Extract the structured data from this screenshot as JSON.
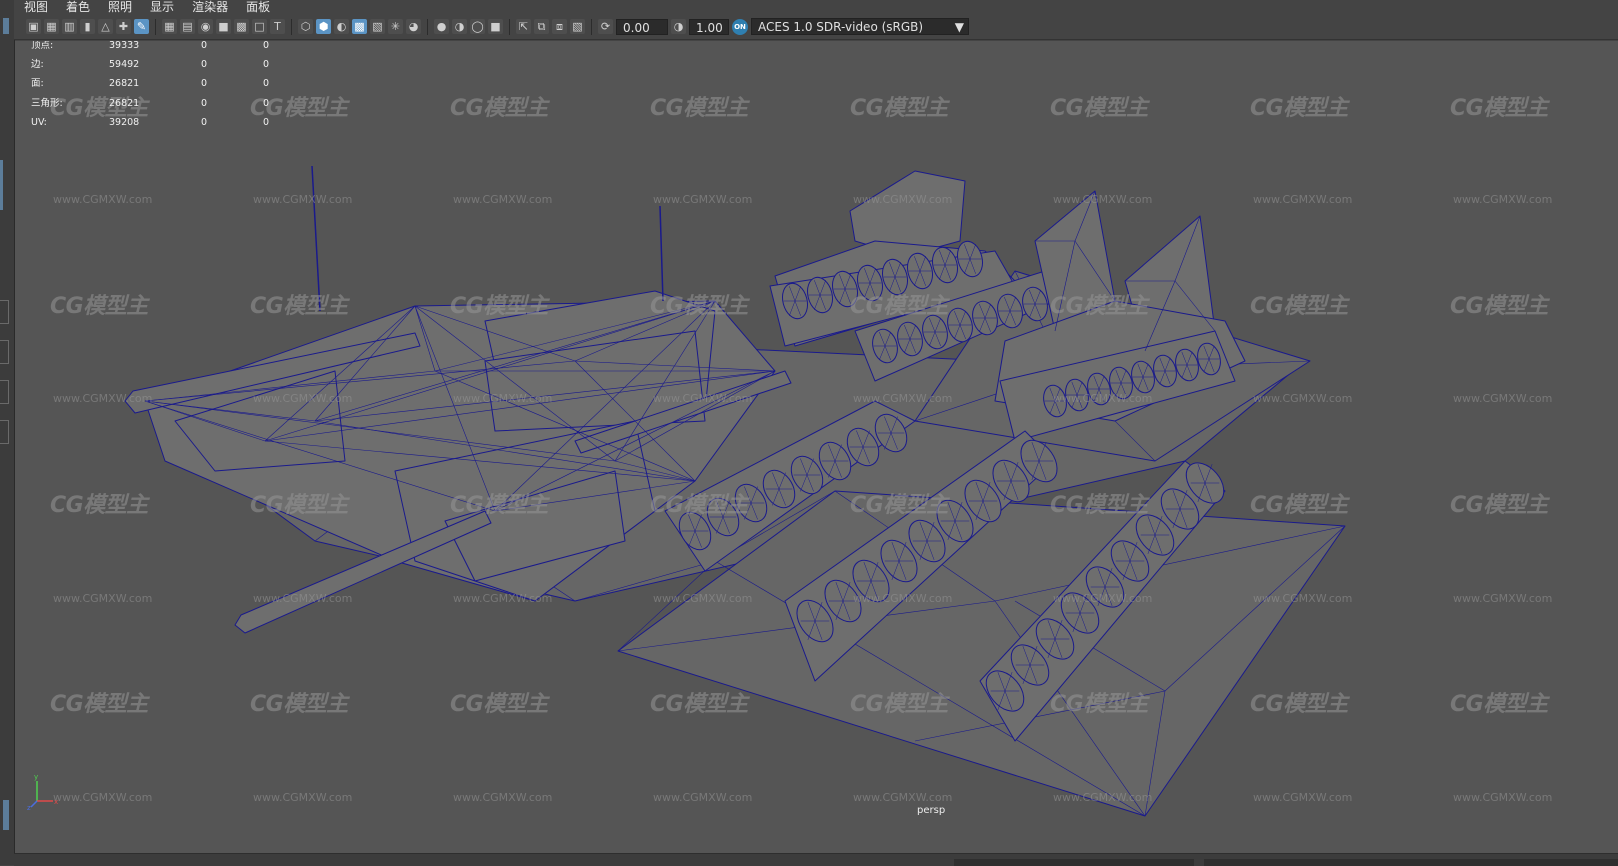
{
  "menu": [
    "视图",
    "着色",
    "照明",
    "显示",
    "渲染器",
    "面板"
  ],
  "toolbar": {
    "icons_group1": [
      "camera-icon",
      "camera-attr-icon",
      "bookmark-icon",
      "image-plane-icon",
      "grid-snap-icon",
      "move-pivot-icon",
      "pencil-icon"
    ],
    "icons_group2": [
      "grid-icon",
      "film-gate-icon",
      "resolution-gate-icon",
      "gate-mask-icon",
      "field-chart-icon",
      "safe-action-icon",
      "safe-title-icon"
    ],
    "icons_group3": [
      "wireframe-icon",
      "smooth-shade-icon",
      "default-material-icon",
      "textured-icon",
      "use-lights-icon",
      "shadows-icon"
    ],
    "icons_group4": [
      "ambient-occlusion-icon",
      "motion-blur-icon",
      "antialias-icon",
      "depth-of-field-icon"
    ],
    "icons_group5": [
      "isolate-select-icon",
      "xray-icon",
      "xray-joints-icon",
      "backface-icon"
    ],
    "exposure_value": "0.00",
    "gamma_value": "1.00",
    "cm_badge": "ON",
    "color_space": "ACES 1.0 SDR-video (sRGB)"
  },
  "hud": [
    {
      "label": "顶点:",
      "v1": "39333",
      "v2": "0",
      "v3": "0"
    },
    {
      "label": "边:",
      "v1": "59492",
      "v2": "0",
      "v3": "0"
    },
    {
      "label": "面:",
      "v1": "26821",
      "v2": "0",
      "v3": "0"
    },
    {
      "label": "三角形:",
      "v1": "26821",
      "v2": "0",
      "v3": "0"
    },
    {
      "label": "UV:",
      "v1": "39208",
      "v2": "0",
      "v3": "0"
    }
  ],
  "watermark": {
    "logo": "CG模型主",
    "url": "www.CGMXW.com"
  },
  "camera_label": "persp",
  "axis": {
    "x": "x",
    "y": "y",
    "z": "z"
  },
  "colors": {
    "viewport_bg": "#555555",
    "wire": "#1a1a8c",
    "mesh_fill": "#6e6e6e",
    "ui_bg": "#444444",
    "accent": "#5b94c4"
  }
}
